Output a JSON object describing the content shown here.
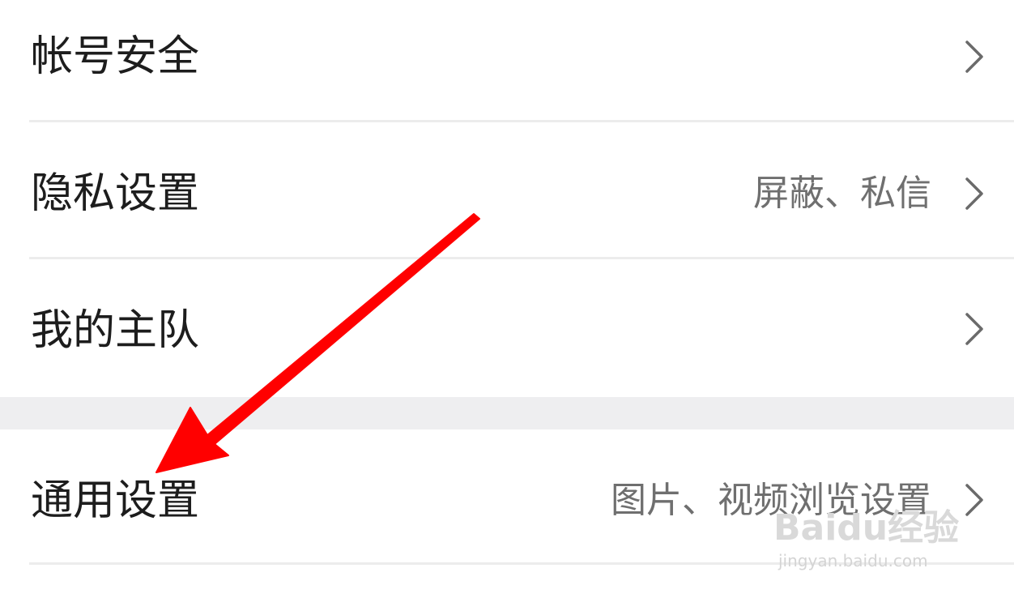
{
  "settings": {
    "items": [
      {
        "label": "帐号安全",
        "value": ""
      },
      {
        "label": "隐私设置",
        "value": "屏蔽、私信"
      },
      {
        "label": "我的主队",
        "value": ""
      },
      {
        "label": "通用设置",
        "value": "图片、视频浏览设置"
      }
    ]
  },
  "colors": {
    "annotation_arrow": "#ff0000",
    "section_gap": "#eeeef0",
    "divider": "#ececec"
  },
  "icons": {
    "chevron": "chevron-right-icon"
  },
  "watermark": {
    "brand": "Baidu经验",
    "url": "jingyan.baidu.com"
  }
}
